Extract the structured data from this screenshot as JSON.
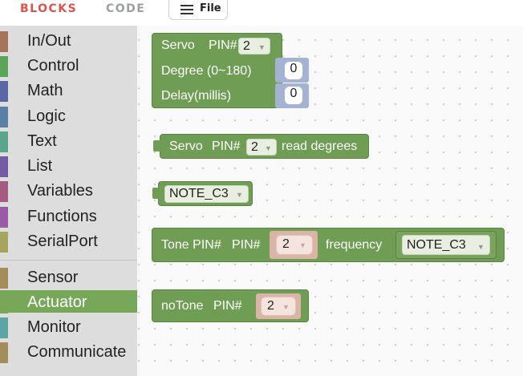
{
  "topbar": {
    "tab_blocks": "BLOCKS",
    "tab_code": "CODE",
    "file_label": "File"
  },
  "sidebar": {
    "categories": [
      {
        "label": "In/Out",
        "color": "#a5745b"
      },
      {
        "label": "Control",
        "color": "#5ba55b"
      },
      {
        "label": "Math",
        "color": "#5b67a5"
      },
      {
        "label": "Logic",
        "color": "#5b80a5"
      },
      {
        "label": "Text",
        "color": "#5ba58c"
      },
      {
        "label": "List",
        "color": "#745ba5"
      },
      {
        "label": "Variables",
        "color": "#a55b80"
      },
      {
        "label": "Functions",
        "color": "#995ba5"
      },
      {
        "label": "SerialPort",
        "color": "#a5a55b"
      },
      {
        "label": "Sensor",
        "color": "#a58c5b"
      },
      {
        "label": "Actuator",
        "color": "#77a85a",
        "selected": true
      },
      {
        "label": "Monitor",
        "color": "#5ba5a5"
      },
      {
        "label": "Communicate",
        "color": "#a58c5b"
      }
    ]
  },
  "workspace": {
    "servo_block": {
      "title": "Servo",
      "pin_label": "PIN#",
      "pin_value": "2",
      "degree_label": "Degree (0~180)",
      "degree_value": "0",
      "delay_label": "Delay(millis)",
      "delay_value": "0"
    },
    "servo_read_block": {
      "title": "Servo",
      "pin_label": "PIN#",
      "pin_value": "2",
      "suffix": "read degrees"
    },
    "note_block": {
      "value": "NOTE_C3"
    },
    "tone_block": {
      "title": "Tone PIN#",
      "pin_label": "PIN#",
      "pin_value": "2",
      "frequency_label": "frequency",
      "frequency_value": "NOTE_C3"
    },
    "notone_block": {
      "title": "noTone",
      "pin_label": "PIN#",
      "pin_value": "2"
    }
  }
}
